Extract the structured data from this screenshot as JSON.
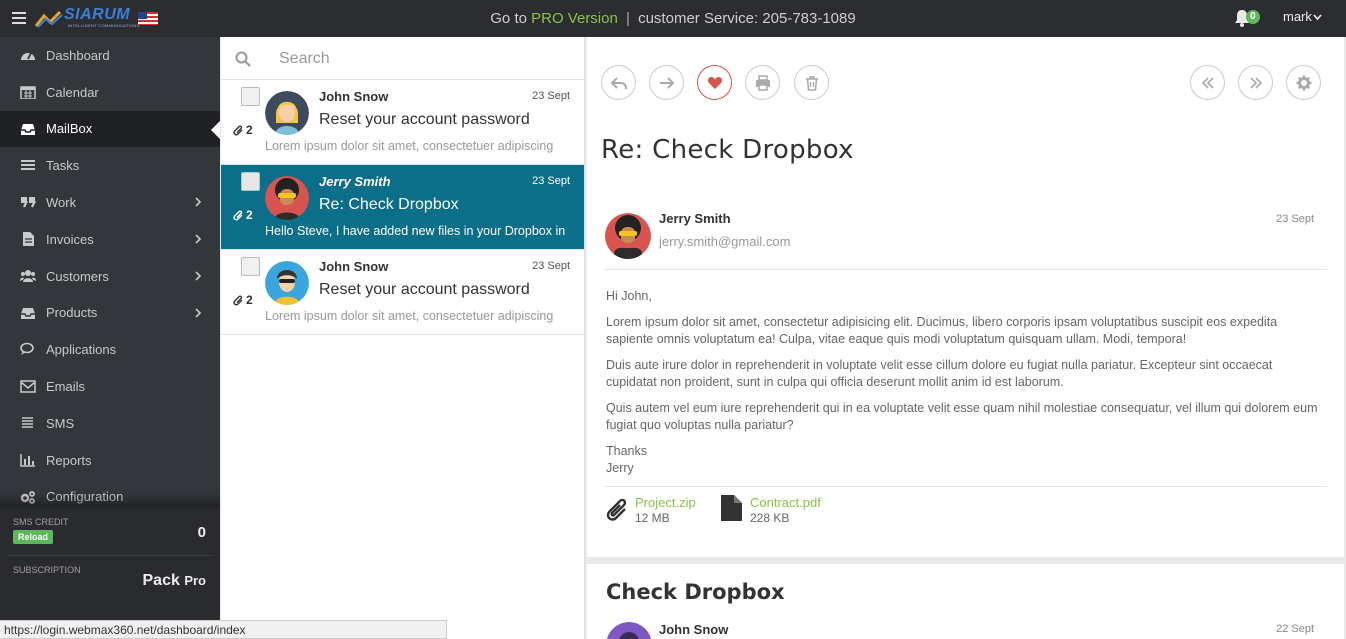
{
  "brand": {
    "name": "SIARUM",
    "tagline": "INTELLIGENT COMMUNICATIONS"
  },
  "topbar": {
    "go_to": "Go to",
    "pro_link": "PRO Version",
    "separator": "|",
    "service_text": "customer Service: 205-783-1089",
    "notification_count": "0",
    "user": "mark"
  },
  "colors": {
    "accent_green": "#8bc34a",
    "selected_row": "#0c6f8a",
    "sidebar_bg": "#33363b",
    "topbar_bg": "#2b2d30",
    "heart_red": "#d9534f"
  },
  "sidebar": {
    "items": [
      {
        "label": "Dashboard",
        "icon": "dashboard-icon",
        "has_chevron": false,
        "active": false
      },
      {
        "label": "Calendar",
        "icon": "calendar-icon",
        "has_chevron": false,
        "active": false
      },
      {
        "label": "MailBox",
        "icon": "inbox-icon",
        "has_chevron": false,
        "active": true
      },
      {
        "label": "Tasks",
        "icon": "tasks-icon",
        "has_chevron": false,
        "active": false
      },
      {
        "label": "Work",
        "icon": "quote-icon",
        "has_chevron": true,
        "active": false
      },
      {
        "label": "Invoices",
        "icon": "file-icon",
        "has_chevron": true,
        "active": false
      },
      {
        "label": "Customers",
        "icon": "users-icon",
        "has_chevron": true,
        "active": false
      },
      {
        "label": "Products",
        "icon": "box-icon",
        "has_chevron": true,
        "active": false
      },
      {
        "label": "Applications",
        "icon": "comments-icon",
        "has_chevron": false,
        "active": false
      },
      {
        "label": "Emails",
        "icon": "envelope-icon",
        "has_chevron": false,
        "active": false
      },
      {
        "label": "SMS",
        "icon": "sms-icon",
        "has_chevron": false,
        "active": false
      },
      {
        "label": "Reports",
        "icon": "chart-icon",
        "has_chevron": false,
        "active": false
      },
      {
        "label": "Configuration",
        "icon": "gears-icon",
        "has_chevron": false,
        "active": false
      }
    ],
    "credit_label": "SMS CREDIT",
    "reload_label": "Reload",
    "credit_value": "0",
    "subscription_label": "SUBSCRIPTION",
    "subscription_value": "Pack",
    "subscription_tier": "Pro"
  },
  "search": {
    "placeholder": "Search"
  },
  "mails": [
    {
      "sender": "John Snow",
      "date": "23 Sept",
      "subject": "Reset your account password",
      "preview": "Lorem ipsum dolor sit amet, consectetuer adipiscing",
      "attachments": "2",
      "selected": false,
      "avatar": "blonde-woman-avatar"
    },
    {
      "sender": "Jerry Smith",
      "date": "23 Sept",
      "subject": "Re: Check Dropbox",
      "preview": "Hello Steve, I have added new files in your Dropbox in",
      "attachments": "2",
      "selected": true,
      "avatar": "afro-man-avatar"
    },
    {
      "sender": "John Snow",
      "date": "23 Sept",
      "subject": "Reset your account password",
      "preview": "Lorem ipsum dolor sit amet, consectetuer adipiscing",
      "attachments": "2",
      "selected": false,
      "avatar": "woman-sunglasses-avatar"
    }
  ],
  "message": {
    "title": "Re: Check Dropbox",
    "from_name": "Jerry Smith",
    "from_email": "jerry.smith@gmail.com",
    "date": "23 Sept",
    "greeting": "Hi John,",
    "paragraphs": [
      "Lorem ipsum dolor sit amet, consectetur adipisicing elit. Ducimus, libero corporis ipsam voluptatibus suscipit eos expedita sapiente omnis voluptatum ea! Culpa, vitae eaque quis modi voluptatum quisquam ullam. Modi, tempora!",
      "Duis aute irure dolor in reprehenderit in voluptate velit esse cillum dolore eu fugiat nulla pariatur. Excepteur sint occaecat cupidatat non proident, sunt in culpa qui officia deserunt mollit anim id est laborum.",
      "Quis autem vel eum iure reprehenderit qui in ea voluptate velit esse quam nihil molestiae consequatur, vel illum qui dolorem eum fugiat quo voluptas nulla pariatur?"
    ],
    "thanks": "Thanks",
    "signature": "Jerry",
    "attachments": [
      {
        "name": "Project.zip",
        "size": "12 MB",
        "icon": "paperclip-icon"
      },
      {
        "name": "Contract.pdf",
        "size": "228 KB",
        "icon": "document-icon"
      }
    ]
  },
  "previous_message": {
    "title": "Check Dropbox",
    "from_name": "John Snow",
    "date": "22 Sept"
  },
  "status_url": "https://login.webmax360.net/dashboard/index"
}
